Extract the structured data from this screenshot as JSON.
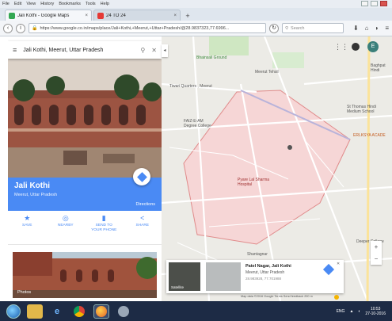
{
  "browser": {
    "menu": [
      "File",
      "Edit",
      "View",
      "History",
      "Bookmarks",
      "Tools",
      "Help"
    ],
    "tabs": [
      {
        "label": "Jali Kothi - Google Maps",
        "active": true,
        "favicon_color": "#34a853"
      },
      {
        "label": "24 TO 24",
        "active": false,
        "favicon_color": "#e53935"
      }
    ],
    "url": "https://www.google.co.in/maps/place/Jali+Kothi,+Meerut,+Uttar+Pradesh/@28.9837323,77.6996...",
    "search_placeholder": "Search"
  },
  "panel": {
    "search_query": "Jali Kothi, Meerut, Uttar Pradesh",
    "place_name": "Jali Kothi",
    "place_location": "Meerut, Uttar Pradesh",
    "directions_label": "Directions",
    "actions": [
      {
        "icon": "star-icon",
        "label": "SAVE"
      },
      {
        "icon": "nearby-icon",
        "label": "NEARBY"
      },
      {
        "icon": "phone-icon",
        "label": "SEND TO YOUR PHONE"
      },
      {
        "icon": "share-icon",
        "label": "SHARE"
      }
    ],
    "photos_label": "Photos"
  },
  "map": {
    "labels": [
      {
        "text": "Bhainsali Ground"
      },
      {
        "text": "Meerut Tehsil"
      },
      {
        "text": "Tiwari Quarters , Meerut"
      },
      {
        "text": "FAIZ-E-AM Degree College"
      },
      {
        "text": "St Thomas Hindi Medium School"
      },
      {
        "text": "ERLKSYA ACADE"
      },
      {
        "text": "Pyare Lal Sharma Hospital"
      },
      {
        "text": "Shantagnar"
      },
      {
        "text": "Baghpat Hindi"
      },
      {
        "text": "Deeper College"
      }
    ],
    "avatar_letter": "E",
    "card": {
      "title": "Patel Nagar, Jali Kothi",
      "subtitle": "Meerut, Uttar Pradesh",
      "coords": "28.983928, 77.701988",
      "satellite_label": "Satellite"
    },
    "attribution": "Map data ©2016 Google   Terms   Send feedback   200 m"
  },
  "taskbar": {
    "lang": "ENG",
    "time": "10:53",
    "date": "27-10-2016"
  }
}
